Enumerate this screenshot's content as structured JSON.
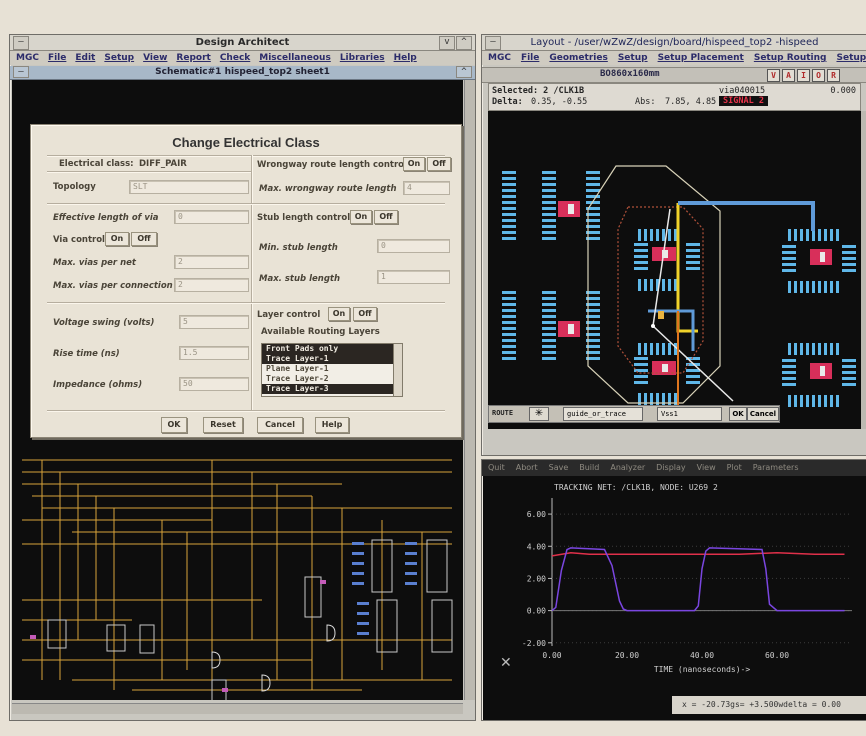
{
  "design_architect": {
    "title": "Design Architect",
    "menu": [
      "MGC",
      "File",
      "Edit",
      "Setup",
      "View",
      "Report",
      "Check",
      "Miscellaneous",
      "Libraries",
      "Help"
    ],
    "schematic_title": "Schematic#1 hispeed_top2 sheet1"
  },
  "dialog": {
    "title": "Change Electrical Class",
    "electrical_class_label": "Electrical class:",
    "electrical_class_value": "DIFF_PAIR",
    "topology_label": "Topology",
    "topology_value": "SLT",
    "effective_length_label": "Effective length of via",
    "effective_length_value": "0",
    "via_control_label": "Via control",
    "max_vias_per_net_label": "Max. vias per net",
    "max_vias_per_net_value": "2",
    "max_vias_per_conn_label": "Max. vias per connection",
    "max_vias_per_conn_value": "2",
    "wrongway_label": "Wrongway route length control",
    "max_wrongway_label": "Max. wrongway route length",
    "max_wrongway_value": "4",
    "stub_control_label": "Stub length control",
    "min_stub_label": "Min. stub length",
    "min_stub_value": "0",
    "max_stub_label": "Max. stub length",
    "max_stub_value": "1",
    "voltage_swing_label": "Voltage swing (volts)",
    "voltage_swing_value": "5",
    "rise_time_label": "Rise time (ns)",
    "rise_time_value": "1.5",
    "impedance_label": "Impedance (ohms)",
    "impedance_value": "50",
    "layer_control_label": "Layer control",
    "available_layers_label": "Available Routing Layers",
    "on_label": "On",
    "off_label": "Off",
    "layers": [
      {
        "name": "Front Pads only",
        "selected": true
      },
      {
        "name": "Trace Layer-1",
        "selected": true
      },
      {
        "name": "Plane Layer-1",
        "selected": false
      },
      {
        "name": "Trace Layer-2",
        "selected": false
      },
      {
        "name": "Trace Layer-3",
        "selected": true
      }
    ],
    "ok_label": "OK",
    "reset_label": "Reset",
    "cancel_label": "Cancel",
    "help_label": "Help"
  },
  "layout": {
    "title": "Layout - /user/wZwZ/design/board/hispeed_top2 -hispeed",
    "menu": [
      "MGC",
      "File",
      "Geometries",
      "Setup",
      "Setup Placement",
      "Setup Routing",
      "Setup I"
    ],
    "board_label": "BO860x160mm",
    "toggles": [
      "V",
      "A",
      "I",
      "O",
      "R"
    ],
    "selected_label": "Selected: 2 /CLK1B",
    "via_label": "via040015",
    "via_value": "0.000",
    "delta_label": "Delta:",
    "delta_value": "0.35, -0.55",
    "abs_label": "Abs:",
    "abs_value": "7.85, 4.85",
    "signal_label": "SIGNAL 2",
    "route_label": "ROUTE",
    "route_mode": "guide_or_trace",
    "net_value": "Vss1",
    "ok_label": "OK",
    "cancel_label": "Cancel"
  },
  "waveform": {
    "menu": [
      "Quit",
      "Abort",
      "Save",
      "Build",
      "Analyzer",
      "Display",
      "View",
      "Plot",
      "Parameters"
    ],
    "title_text": "TRACKING NET: /CLK1B,   NODE: U269 2",
    "status_text": "x = -20.73gs= +3.500wdelta = 0.00"
  },
  "chart_data": {
    "type": "line",
    "title": "TRACKING NET: /CLK1B,   NODE: U269 2",
    "xlabel": "TIME (nanoseconds)->",
    "ylabel": "",
    "xlim": [
      0,
      80
    ],
    "ylim": [
      -2.2,
      7
    ],
    "x_ticks": [
      "0.00",
      "20.00",
      "40.00",
      "60.00"
    ],
    "y_ticks": [
      "-2.00",
      "0.00",
      "2.00",
      "4.00",
      "6.00"
    ],
    "series": [
      {
        "color": "#e0304a",
        "x": [
          0,
          5,
          10,
          20,
          30,
          40,
          50,
          60,
          70,
          78
        ],
        "y": [
          3.4,
          3.6,
          3.5,
          3.5,
          3.5,
          3.5,
          3.5,
          3.6,
          3.5,
          3.5
        ]
      },
      {
        "color": "#7a46e0",
        "x": [
          0,
          1,
          2.5,
          4,
          5,
          14,
          16,
          18,
          19,
          20,
          25,
          38,
          39,
          40,
          41,
          42,
          56,
          57,
          58,
          60,
          78
        ],
        "y": [
          0,
          0.2,
          2.5,
          3.8,
          3.9,
          3.8,
          2.8,
          0.6,
          0.1,
          0,
          0,
          0,
          0.3,
          2.6,
          3.7,
          3.9,
          3.8,
          2.6,
          0.4,
          0,
          0
        ]
      }
    ]
  }
}
